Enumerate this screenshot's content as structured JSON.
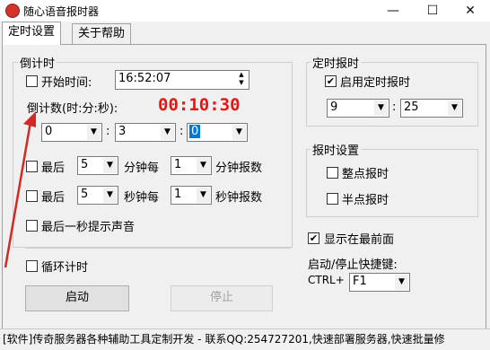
{
  "window": {
    "title": "随心语音报时器",
    "minimize": "—",
    "maximize": "☐",
    "close": "✕"
  },
  "tabs": [
    {
      "label": "定时设置"
    },
    {
      "label": "关于帮助"
    }
  ],
  "countdown": {
    "group_label": "倒计时",
    "start_time_label": "开始时间:",
    "start_time_value": "16:52:07",
    "count_label": "倒计数(时:分:秒):",
    "timer_display": "00:10:30",
    "hours": "0",
    "minutes": "3",
    "seconds": "0",
    "sep": ":",
    "last1": {
      "prefix": "最后",
      "value": "5",
      "mid": "分钟每",
      "value2": "1",
      "suffix": "分钟报数"
    },
    "last2": {
      "prefix": "最后",
      "value": "5",
      "mid": "秒钟每",
      "value2": "1",
      "suffix": "秒钟报数"
    },
    "last_second_sound": "最后一秒提示声音",
    "loop_label": "循环计时",
    "start_button": "启动",
    "stop_button": "停止"
  },
  "scheduled": {
    "group_label": "定时报时",
    "enable_label": "启用定时报时",
    "hour": "9",
    "minute": "25",
    "sep": ":"
  },
  "announce": {
    "group_label": "报时设置",
    "on_hour": "整点报时",
    "half_hour": "半点报时"
  },
  "front_label": "显示在最前面",
  "hotkey": {
    "label": "启动/停止快捷键:",
    "modifier": "CTRL+",
    "key": "F1"
  },
  "status_bar": "[软件]传奇服务器各种辅助工具定制开发 - 联系QQ:254727201,快速部署服务器,快速批量修",
  "check_mark": "✔",
  "arrow_down": "▼",
  "arrow_up": "▲",
  "colors": {
    "timer": "#ee1111",
    "arrow": "#d12a24",
    "selection": "#0078d7"
  }
}
